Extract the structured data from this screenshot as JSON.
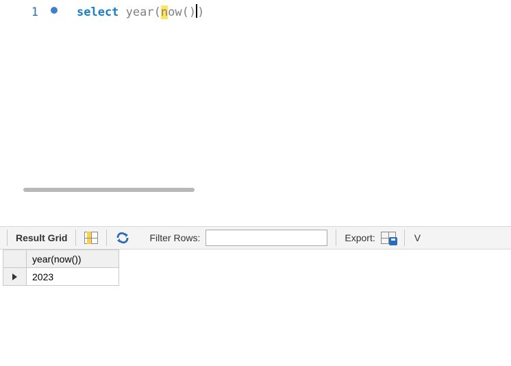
{
  "editor": {
    "line_number": "1",
    "sql": {
      "keyword_select": "select",
      "func_year": "year",
      "open1": "(",
      "func_now_first": "n",
      "func_now_rest": "ow",
      "open2": "(",
      "close2": ")",
      "close1": ")"
    }
  },
  "toolbar": {
    "result_grid_label": "Result Grid",
    "filter_rows_label": "Filter Rows:",
    "filter_value": "",
    "export_label": "Export:",
    "cropped_letter": "V"
  },
  "results": {
    "columns": [
      "year(now())"
    ],
    "rows": [
      {
        "values": [
          "2023"
        ],
        "is_current": true
      }
    ]
  },
  "chart_data": {
    "type": "table",
    "columns": [
      "year(now())"
    ],
    "rows": [
      [
        2023
      ]
    ],
    "title": ""
  },
  "colors": {
    "keyword": "#1a7fc8",
    "function": "#808080",
    "highlight": "#ffe45c",
    "accent": "#2b6cb8"
  }
}
